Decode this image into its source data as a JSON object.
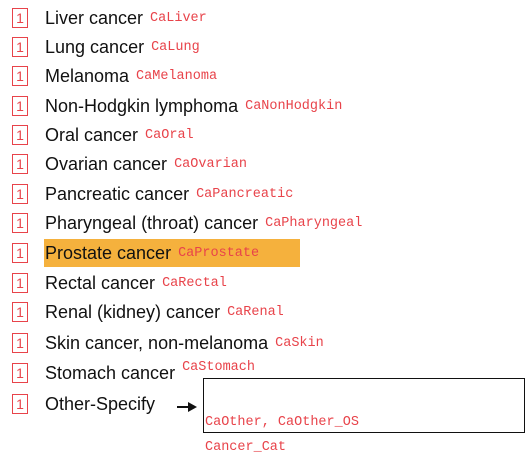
{
  "items": [
    {
      "code": "1",
      "label": "Liver cancer",
      "var": "CaLiver"
    },
    {
      "code": "1",
      "label": "Lung cancer",
      "var": "CaLung"
    },
    {
      "code": "1",
      "label": "Melanoma",
      "var": "CaMelanoma"
    },
    {
      "code": "1",
      "label": "Non-Hodgkin lymphoma",
      "var": "CaNonHodgkin"
    },
    {
      "code": "1",
      "label": "Oral cancer",
      "var": "CaOral"
    },
    {
      "code": "1",
      "label": "Ovarian cancer",
      "var": "CaOvarian"
    },
    {
      "code": "1",
      "label": "Pancreatic cancer",
      "var": "CaPancreatic"
    },
    {
      "code": "1",
      "label": "Pharyngeal (throat) cancer",
      "var": "CaPharyngeal"
    },
    {
      "code": "1",
      "label": "Prostate cancer",
      "var": "CaProstate",
      "highlighted": true
    },
    {
      "code": "1",
      "label": "Rectal cancer",
      "var": "CaRectal"
    },
    {
      "code": "1",
      "label": "Renal (kidney) cancer",
      "var": "CaRenal"
    },
    {
      "code": "1",
      "label": "Skin cancer, non-melanoma",
      "var": "CaSkin"
    },
    {
      "code": "1",
      "label": "Stomach cancer",
      "var": "CaStomach"
    },
    {
      "code": "1",
      "label": "Other-Specify",
      "var": ""
    }
  ],
  "other": {
    "vars": "CaOther, CaOther_OS",
    "category": "Cancer_Cat",
    "arrow_icon": "right-arrow-icon"
  },
  "colors": {
    "code_red": "#e8434a",
    "highlight": "#f5b13d"
  }
}
